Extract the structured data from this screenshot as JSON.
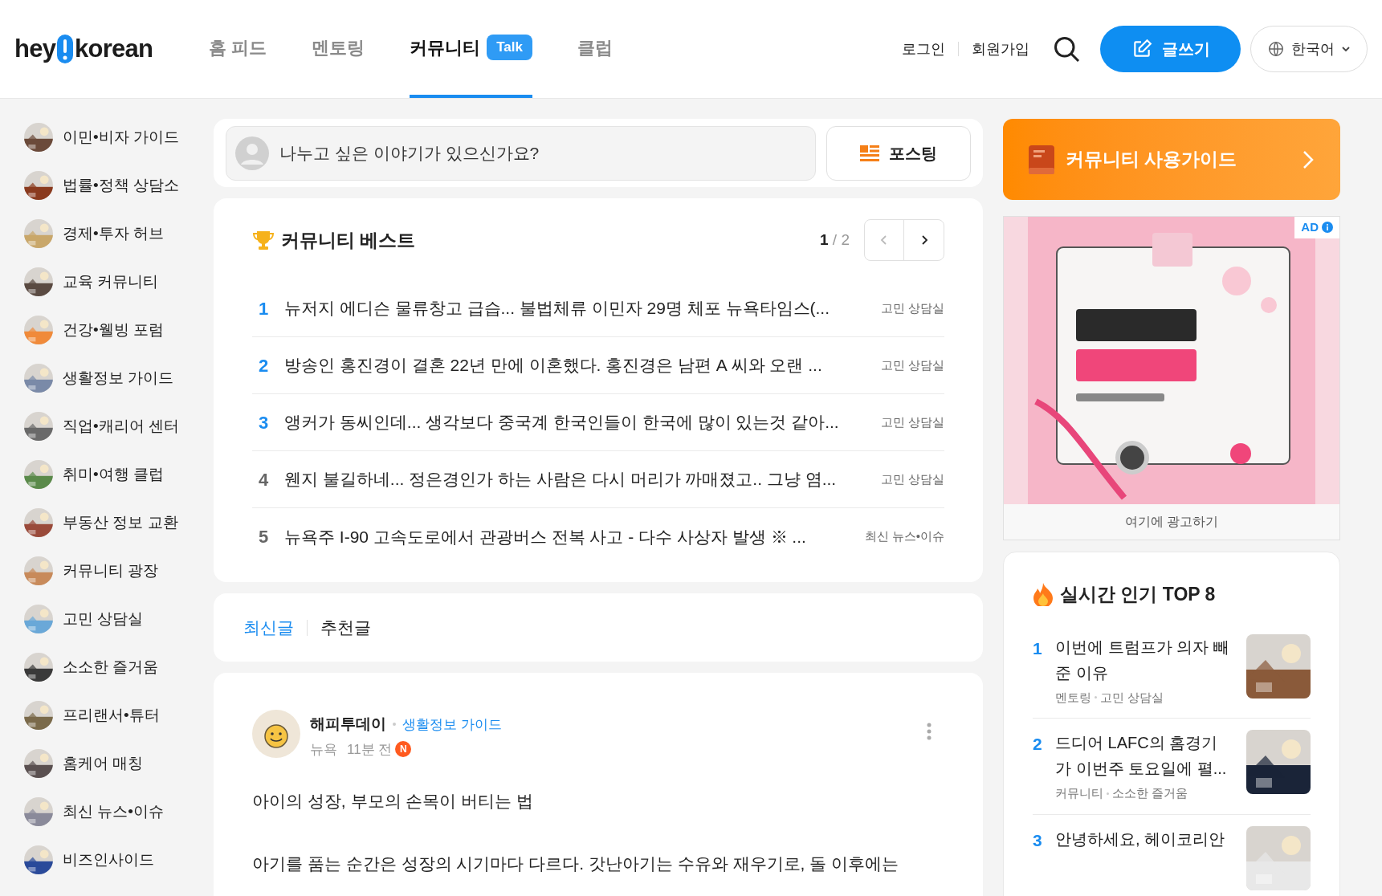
{
  "header": {
    "logo": {
      "left": "hey",
      "right": "korean"
    },
    "nav": [
      {
        "label": "홈 피드",
        "selected": false
      },
      {
        "label": "멘토링",
        "selected": false
      },
      {
        "label": "커뮤니티",
        "selected": true,
        "badge": "Talk"
      },
      {
        "label": "클럽",
        "selected": false
      }
    ],
    "login": "로그인",
    "signup": "회원가입",
    "write_button": "글쓰기",
    "language": "한국어"
  },
  "sidebar": {
    "items": [
      {
        "label": "이민•비자 가이드"
      },
      {
        "label": "법률•정책 상담소"
      },
      {
        "label": "경제•투자 허브"
      },
      {
        "label": "교육 커뮤니티"
      },
      {
        "label": "건강•웰빙 포럼"
      },
      {
        "label": "생활정보 가이드"
      },
      {
        "label": "직업•캐리어 센터"
      },
      {
        "label": "취미•여행 클럽"
      },
      {
        "label": "부동산 정보 교환"
      },
      {
        "label": "커뮤니티 광장"
      },
      {
        "label": "고민 상담실"
      },
      {
        "label": "소소한 즐거움"
      },
      {
        "label": "프리랜서•튜터"
      },
      {
        "label": "홈케어 매칭"
      },
      {
        "label": "최신 뉴스•이슈"
      },
      {
        "label": "비즈인사이드"
      }
    ]
  },
  "composer": {
    "placeholder": "나누고 싶은 이야기가 있으신가요?",
    "post_button": "포스팅"
  },
  "best": {
    "title": "커뮤니티 베스트",
    "page": "1",
    "separator": "/",
    "pages": "2",
    "items": [
      {
        "rank": "1",
        "title": "뉴저지 에디슨 물류창고 급습... 불법체류 이민자 29명 체포 뉴욕타임스(...",
        "board": "고민 상담실",
        "highlight": true
      },
      {
        "rank": "2",
        "title": "방송인 홍진경이 결혼 22년 만에 이혼했다. 홍진경은 남편 A 씨와 오랜 ...",
        "board": "고민 상담실",
        "highlight": true
      },
      {
        "rank": "3",
        "title": "앵커가 동씨인데... 생각보다 중국계 한국인들이 한국에 많이 있는것 같아...",
        "board": "고민 상담실",
        "highlight": true
      },
      {
        "rank": "4",
        "title": "웬지 불길하네... 정은경인가 하는 사람은 다시 머리가 까매졌고.. 그냥 염...",
        "board": "고민 상담실",
        "highlight": false
      },
      {
        "rank": "5",
        "title": "뉴욕주 I-90 고속도로에서 관광버스 전복 사고 - 다수 사상자 발생 ※ ...",
        "board": "최신 뉴스•이슈",
        "highlight": false
      }
    ]
  },
  "feed_tabs": [
    {
      "label": "최신글",
      "selected": true
    },
    {
      "label": "추천글",
      "selected": false
    }
  ],
  "post": {
    "author": "해피투데이",
    "board": "생활정보 가이드",
    "location": "뉴욕",
    "time": "11분 전",
    "new_badge": "N",
    "paragraphs": [
      "아이의 성장, 부모의 손목이 버티는 법",
      "아기를 품는 순간은 성장의 시기마다 다르다. 갓난아기는 수유와 재우기로, 돌 이후에는"
    ]
  },
  "guide_banner": {
    "label": "커뮤니티 사용가이드"
  },
  "ad": {
    "kind": "picture",
    "badge": "AD",
    "caption": "여기에 광고하기"
  },
  "top": {
    "title": "실시간 인기 TOP 8",
    "items": [
      {
        "rank": "1",
        "lines": [
          "이번에 트럼프가 의자 빼",
          "준 이유"
        ],
        "meta": [
          "멘토링",
          "고민 상담실"
        ]
      },
      {
        "rank": "2",
        "lines": [
          "드디어 LAFC의 홈경기",
          "가 이번주 토요일에 펼..."
        ],
        "meta": [
          "커뮤니티",
          "소소한 즐거움"
        ]
      },
      {
        "rank": "3",
        "lines": [
          "안녕하세요, 헤이코리안"
        ]
      }
    ]
  }
}
